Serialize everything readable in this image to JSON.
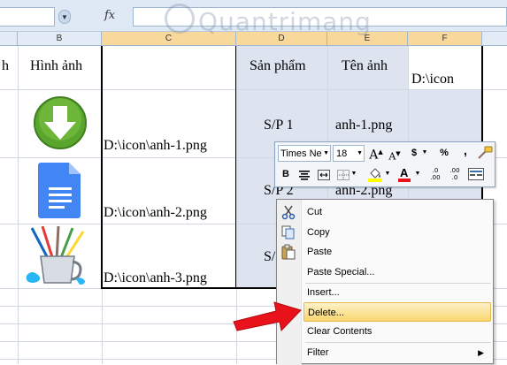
{
  "formula_bar": {
    "fx_label": "fx",
    "name_box": "",
    "value": ""
  },
  "columns": [
    {
      "label": "",
      "selected": false
    },
    {
      "label": "B",
      "selected": false
    },
    {
      "label": "C",
      "selected": true
    },
    {
      "label": "D",
      "selected": true
    },
    {
      "label": "E",
      "selected": true
    },
    {
      "label": "F",
      "selected": true
    }
  ],
  "watermark": "Quantrimang",
  "header_row": {
    "a": "h",
    "b": "Hình ảnh",
    "d": "Sản phẩm",
    "e": "Tên ảnh",
    "f": "D:\\icon"
  },
  "rows": [
    {
      "image": "download-arrow-icon",
      "path": "D:\\icon\\anh-1.png",
      "product": "S/P 1",
      "file": "anh-1.png"
    },
    {
      "image": "google-docs-icon",
      "path": "D:\\icon\\anh-2.png",
      "product": "S/P 2",
      "file": "anh-2.png"
    },
    {
      "image": "paint-brushes-icon",
      "path": "D:\\icon\\anh-3.png",
      "product": "S/",
      "file": ""
    }
  ],
  "mini_toolbar": {
    "font": "Times Ne",
    "size": "18",
    "grow": "A",
    "shrink": "A",
    "currency": "$",
    "percent": "%",
    "comma": ",",
    "bold": "B",
    "inc_decimal": ".0\n.00",
    "dec_decimal": ".00\n.0"
  },
  "context_menu": {
    "items": [
      {
        "label": "Cut",
        "icon": "scissors-icon"
      },
      {
        "label": "Copy",
        "icon": "copy-icon"
      },
      {
        "label": "Paste",
        "icon": "paste-icon"
      },
      {
        "label": "Paste Special...",
        "icon": ""
      },
      {
        "label": "Insert...",
        "icon": ""
      },
      {
        "label": "Delete...",
        "icon": "",
        "highlighted": true
      },
      {
        "label": "Clear Contents",
        "icon": ""
      },
      {
        "label": "Filter",
        "icon": "",
        "submenu": true
      }
    ]
  },
  "colors": {
    "accent": "#f9d66f",
    "selection": "#dde4ef",
    "arrow": "#e8121a",
    "header": "#e3ebf6"
  }
}
